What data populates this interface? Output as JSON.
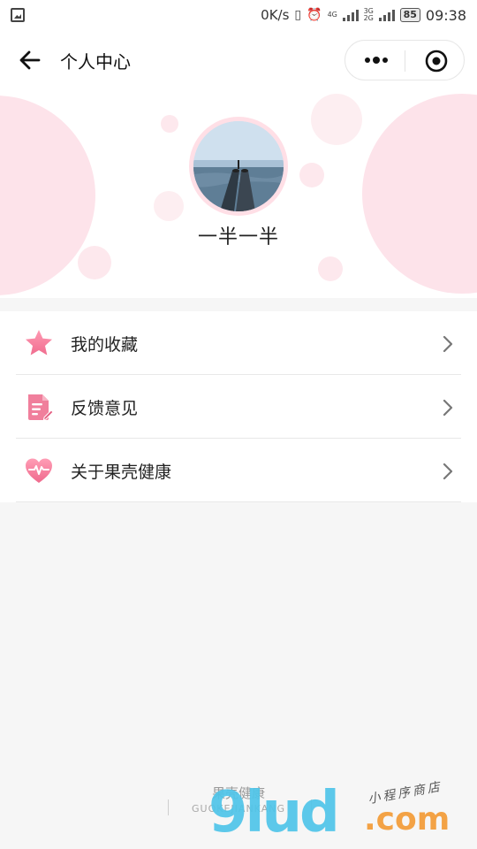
{
  "status_bar": {
    "speed": "0K/s",
    "network_1": "4G",
    "network_2": "3G 2G",
    "battery": "85",
    "time": "09:38"
  },
  "navbar": {
    "title": "个人中心",
    "back_icon": "arrow-left-icon",
    "more_icon": "more-dots-icon",
    "close_icon": "target-circle-icon"
  },
  "profile": {
    "username": "一半一半",
    "avatar_desc_icon": "avatar-photo"
  },
  "menu": {
    "items": [
      {
        "label": "我的收藏",
        "icon": "star-icon"
      },
      {
        "label": "反馈意见",
        "icon": "feedback-document-icon"
      },
      {
        "label": "关于果壳健康",
        "icon": "heart-pulse-icon"
      }
    ]
  },
  "footer": {
    "brand": "果壳健康",
    "sub": "GUOKEJIANKANG"
  },
  "watermark": {
    "main": "9lud",
    "domain": ".com",
    "tag": "小程序商店"
  },
  "colors": {
    "accent_pink": "#f06d8f",
    "bubble_pink": "#fde3ea",
    "background": "#f6f6f6"
  }
}
